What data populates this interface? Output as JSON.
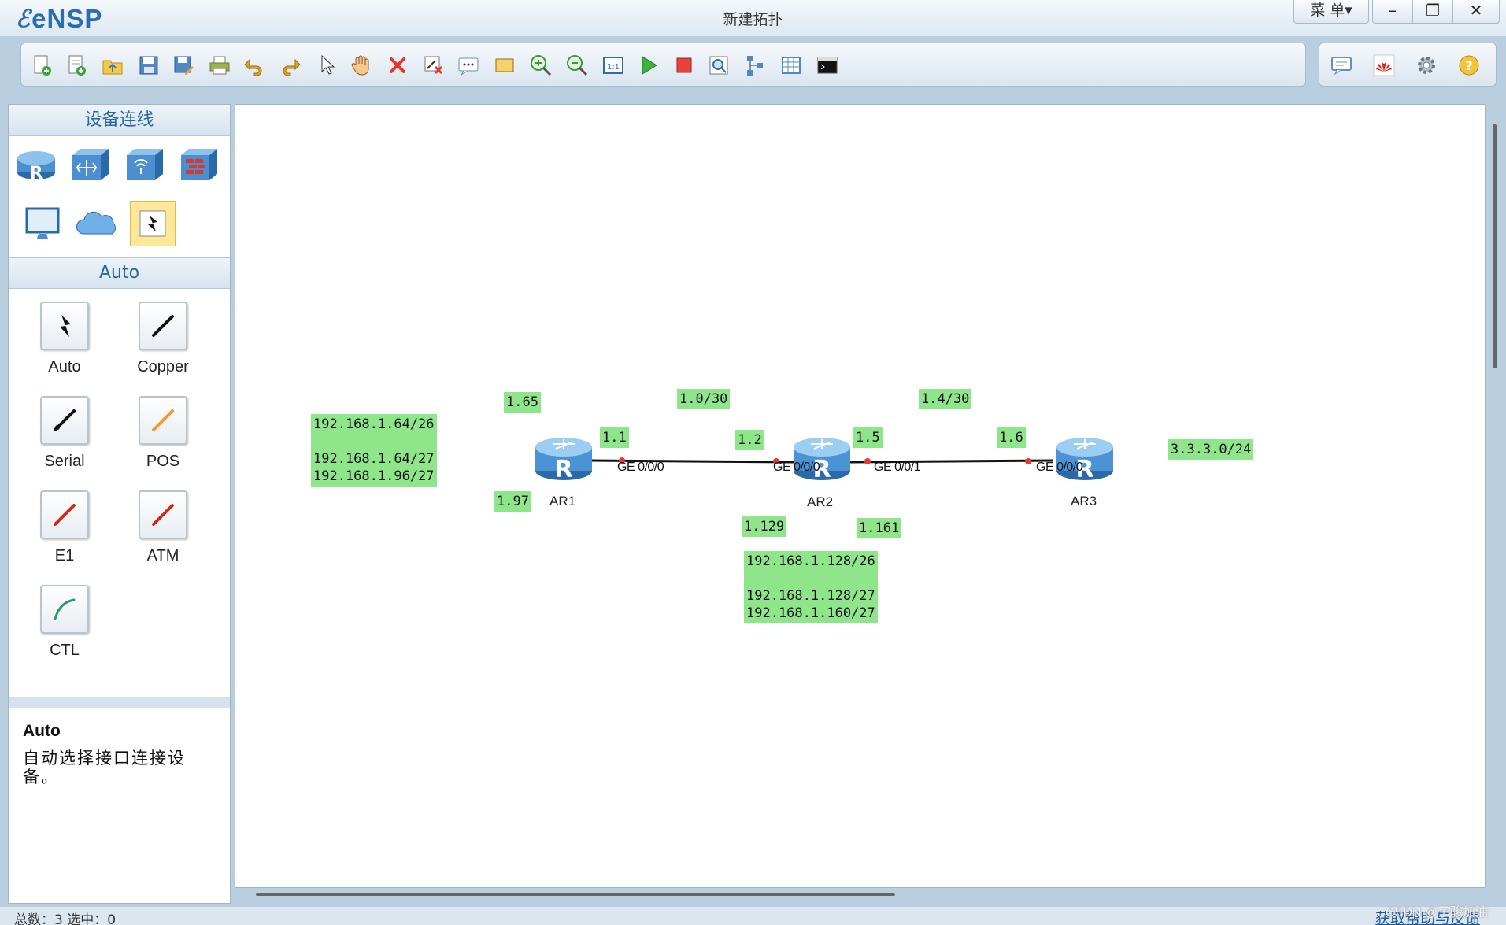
{
  "app": {
    "name": "eNSP",
    "document_title": "新建拓扑"
  },
  "window": {
    "menu_label": "菜 单▾",
    "minimize": "–",
    "maximize": "❐",
    "close": "✕"
  },
  "toolbar": {
    "icons": [
      "new-topology-icon",
      "new-example-icon",
      "open-icon",
      "save-icon",
      "save-as-icon",
      "print-icon",
      "undo-icon",
      "redo-icon",
      "select-cursor-icon",
      "pan-hand-icon",
      "delete-icon",
      "delete-all-links-icon",
      "text-note-icon",
      "rectangle-shape-icon",
      "zoom-in-icon",
      "zoom-out-icon",
      "fit-view-icon",
      "start-device-icon",
      "stop-device-icon",
      "capture-icon",
      "topology-icon",
      "grid-icon",
      "terminal-icon"
    ],
    "right_icons": [
      "forum-icon",
      "huawei-icon",
      "settings-icon",
      "help-icon"
    ]
  },
  "left_panel": {
    "device_header": "设备连线",
    "device_icons": [
      "router-icon",
      "switch-icon",
      "wlan-icon",
      "firewall-icon",
      "pc-icon",
      "cloud-icon",
      "link-icon"
    ],
    "link_header": "Auto",
    "link_types": [
      {
        "label": "Auto"
      },
      {
        "label": "Copper"
      },
      {
        "label": "Serial"
      },
      {
        "label": "POS"
      },
      {
        "label": "E1"
      },
      {
        "label": "ATM"
      },
      {
        "label": "CTL"
      }
    ],
    "description": {
      "title": "Auto",
      "text": "自动选择接口连接设备。"
    }
  },
  "topology": {
    "devices": [
      {
        "name": "AR1"
      },
      {
        "name": "AR2"
      },
      {
        "name": "AR3"
      }
    ],
    "ports": [
      "GE 0/0/0",
      "GE 0/0/0",
      "GE 0/0/1",
      "GE 0/0/0"
    ],
    "labels": {
      "ar1_subnets": "192.168.1.64/26\n\n192.168.1.64/27\n192.168.1.96/27",
      "ar1_ip_65": "1.65",
      "ar1_ip_97": "1.97",
      "ar1_ip_1": "1.1",
      "link1_net": "1.0/30",
      "ar2_ip_2": "1.2",
      "ar2_ip_5": "1.5",
      "link2_net": "1.4/30",
      "ar3_ip_6": "1.6",
      "ar3_loopback": "3.3.3.0/24",
      "ar2_ip_129": "1.129",
      "ar2_ip_161": "1.161",
      "ar2_subnets": "192.168.1.128/26\n\n192.168.1.128/27\n192.168.1.160/27"
    },
    "colors": {
      "label_bg": "#8ee58a",
      "port_dot": "#e53935",
      "router_blue": "#3b8fd6"
    }
  },
  "statusbar": {
    "left": "总数：3 选中：0",
    "right": "获取帮助与反馈"
  },
  "watermark": "CSDN @子骏加油"
}
